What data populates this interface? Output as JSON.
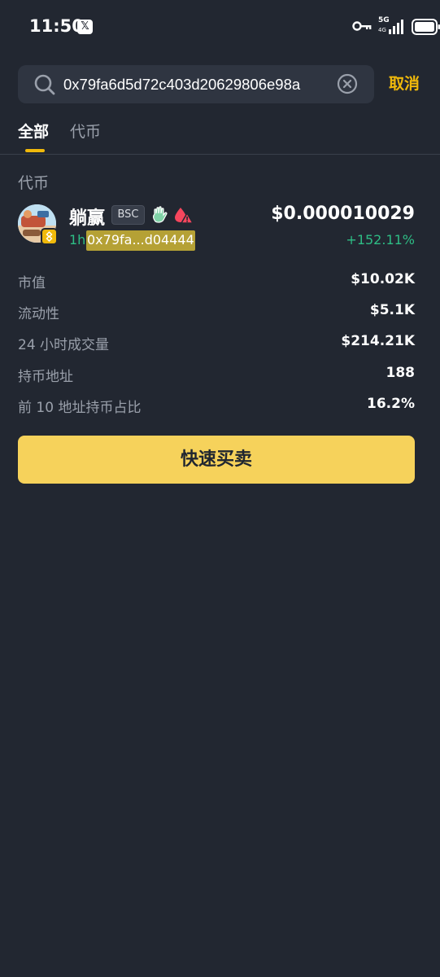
{
  "status_bar": {
    "time": "11:50",
    "app_badge": "𝕏",
    "network": "5G",
    "network_sub": "4G"
  },
  "search": {
    "value": "0x79fa6d5d72c403d20629806e98a",
    "cancel_label": "取消"
  },
  "tabs": [
    {
      "label": "全部",
      "active": true
    },
    {
      "label": "代币",
      "active": false
    }
  ],
  "section_title": "代币",
  "token": {
    "name": "躺赢",
    "chain": "BSC",
    "age": "1h",
    "address": "0x79fa...d04444",
    "price": "$0.000010029",
    "change": "+152.11%"
  },
  "stats": [
    {
      "label": "市值",
      "value": "$10.02K"
    },
    {
      "label": "流动性",
      "value": "$5.1K"
    },
    {
      "label": "24 小时成交量",
      "value": "$214.21K"
    },
    {
      "label": "持币地址",
      "value": "188"
    },
    {
      "label": "前 10 地址持币占比",
      "value": "16.2%"
    }
  ],
  "quick_trade_label": "快速买卖",
  "colors": {
    "background": "#222731",
    "accent": "#f0b90b",
    "button": "#f6d25b",
    "positive": "#2ebd85",
    "muted_text": "#9aa0ab"
  }
}
